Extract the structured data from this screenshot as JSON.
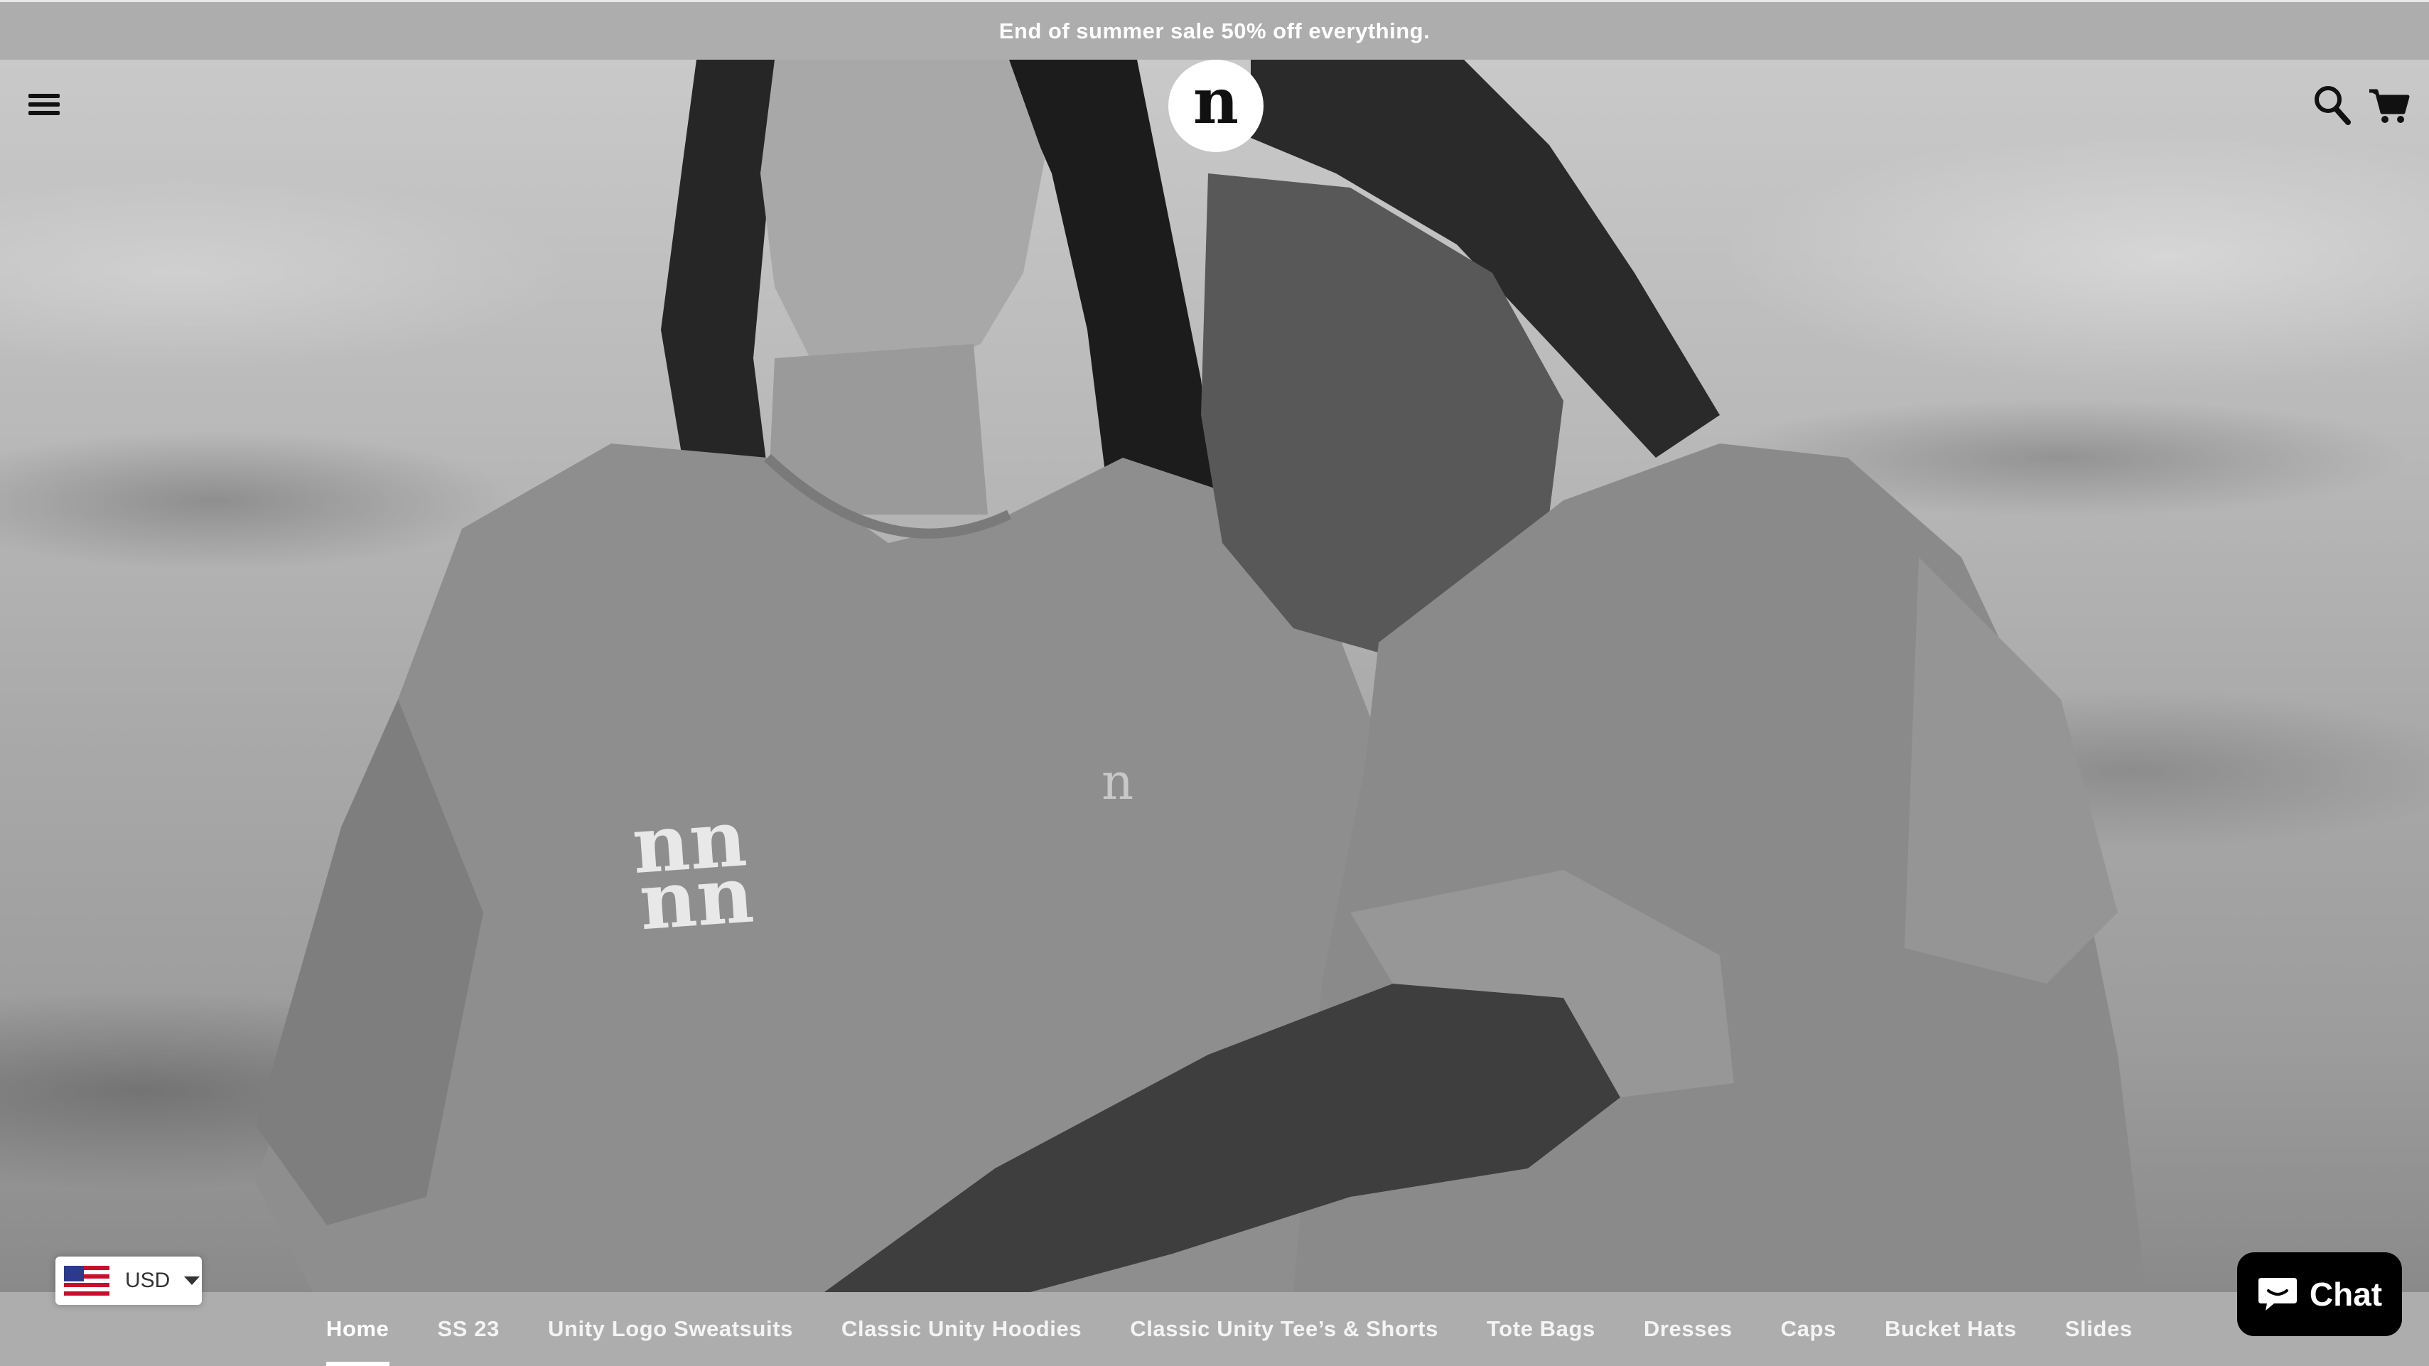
{
  "announcement": {
    "text": "End of summer sale 50% off everything."
  },
  "header": {
    "logo_text": "n",
    "menu_icon": "hamburger-menu-icon",
    "search_icon": "search-icon",
    "cart_icon": "cart-icon"
  },
  "hero": {
    "image": "black-and-white photo of two women in t-shirts embracing",
    "shirt_print_left": "nn nn",
    "shirt_print_small": "n"
  },
  "nav": {
    "items": [
      {
        "label": "Home",
        "active": true
      },
      {
        "label": "SS 23"
      },
      {
        "label": "Unity Logo Sweatsuits"
      },
      {
        "label": "Classic Unity Hoodies"
      },
      {
        "label": "Classic Unity Tee’s & Shorts"
      },
      {
        "label": "Tote Bags"
      },
      {
        "label": "Dresses"
      },
      {
        "label": "Caps"
      },
      {
        "label": "Bucket Hats"
      },
      {
        "label": "Slides"
      }
    ]
  },
  "currency": {
    "code": "USD",
    "flag_icon": "us-flag-icon"
  },
  "chat": {
    "label": "Chat",
    "icon": "chat-bubble-icon"
  },
  "colors": {
    "announcement_bg": "#adadad",
    "nav_bg": "#adadad",
    "chat_bg": "#000000",
    "text_light": "#ffffff"
  }
}
